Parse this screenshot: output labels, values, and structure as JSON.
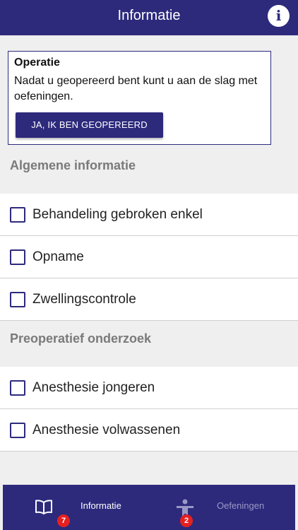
{
  "header": {
    "title": "Informatie",
    "info_icon": "info-icon"
  },
  "card": {
    "title": "Operatie",
    "text": "Nadat u geopereerd bent kunt u aan de slag met oefeningen.",
    "button_label": "JA, IK BEN GEOPEREERD"
  },
  "sections": [
    {
      "title": "Algemene informatie",
      "items": [
        {
          "label": "Behandeling gebroken enkel",
          "checked": false
        },
        {
          "label": "Opname",
          "checked": false
        },
        {
          "label": "Zwellingscontrole",
          "checked": false
        }
      ]
    },
    {
      "title": "Preoperatief onderzoek",
      "items": [
        {
          "label": "Anesthesie jongeren",
          "checked": false
        },
        {
          "label": "Anesthesie volwassenen",
          "checked": false
        }
      ]
    }
  ],
  "bottom_nav": {
    "tabs": [
      {
        "label": "Informatie",
        "icon": "book-icon",
        "badge": "7",
        "active": true
      },
      {
        "label": "Oefeningen",
        "icon": "person-icon",
        "badge": "2",
        "active": false
      }
    ]
  },
  "colors": {
    "primary": "#2d2a7c",
    "background": "#efefef",
    "badge": "#e52020",
    "section_title": "#7a7a7a"
  }
}
